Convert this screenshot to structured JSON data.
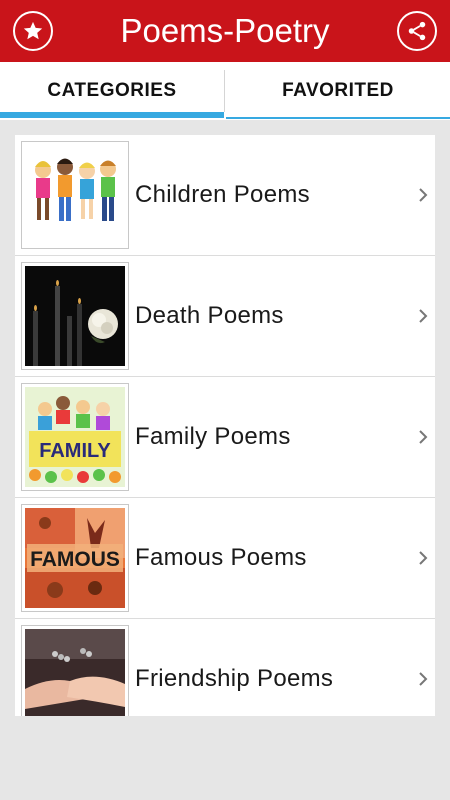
{
  "app": {
    "title": "Poems-Poetry",
    "left_icon": "star-icon",
    "right_icon": "share-icon",
    "accent_color": "#c9141a",
    "tab_indicator_color": "#36a9e1"
  },
  "tabs": [
    {
      "label": "CATEGORIES",
      "selected": true
    },
    {
      "label": "FAVORITED",
      "selected": false
    }
  ],
  "categories": [
    {
      "label": "Children Poems",
      "thumbnail": "children-group-illustration"
    },
    {
      "label": "Death Poems",
      "thumbnail": "candles-and-white-rose"
    },
    {
      "label": "Family Poems",
      "thumbnail": "family-letters-illustration",
      "thumbnail_text": "FAMILY"
    },
    {
      "label": "Famous Poems",
      "thumbnail": "famous-collage",
      "thumbnail_text": "FAMOUS"
    },
    {
      "label": "Friendship Poems",
      "thumbnail": "holding-hands-photo"
    }
  ]
}
